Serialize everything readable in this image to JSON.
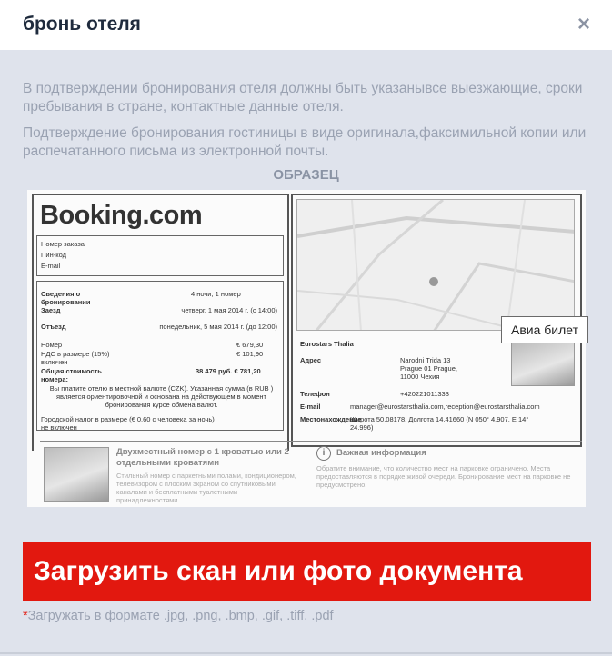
{
  "modal": {
    "title": "бронь отеля",
    "close_glyph": "×"
  },
  "instructions": {
    "paragraph_1": "В подтверждении бронирования отеля должны быть указанывсе выезжающие, сроки пребывания в стране, контактные данные отеля.",
    "paragraph_2": "Подтверждение бронирования гостиницы в виде оригинала,факсимильной копии или распечатанного письма из электронной почты.",
    "sample_label": "ОБРАЗЕЦ"
  },
  "sample_document": {
    "brand": "Booking.com",
    "left_fields": [
      "Номер заказа",
      "Пин-код",
      "E-mail"
    ],
    "details": [
      {
        "label": "Сведения о бронировании",
        "value": "4 ночи, 1 номер"
      },
      {
        "label": "Заезд",
        "value": "четверг, 1 мая 2014 г. (с 14:00)"
      },
      {
        "label": "Отъезд",
        "value": "понедельник, 5 мая 2014 г. (до 12:00)"
      },
      {
        "label": "Номер",
        "value": "€ 679,30"
      },
      {
        "label": "НДС в размере (15%) включен",
        "value": "€ 101,90"
      },
      {
        "label": "Общая стоимость номера:",
        "value": "38 479 руб. € 781,20"
      }
    ],
    "currency_note": "Вы платите отелю в местной валюте (CZK). Указанная сумма (в RUB ) является ориентировочной и основана на действующем в момент бронирования курсе обмена валют.",
    "tax_note": "Городской налог в размере (€ 0.60 с человека за ночь) не включен",
    "hotel_name": "Eurostars Thalia",
    "hotel_fields": [
      {
        "label": "Адрес",
        "value": "Narodni Trida 13 Prague 01 Prague, 11000 Чехия"
      },
      {
        "label": "Телефон",
        "value": "+420221011333"
      },
      {
        "label": "E-mail",
        "value": "manager@eurostarsthalia.com,reception@eurostarsthalia.com"
      },
      {
        "label": "Местонахождение",
        "value": "Широта 50.08178, Долгота 14.41660 (N 050° 4.907, E 14° 24.996)"
      }
    ],
    "room_title": "Двухместный номер с 1 кроватью или 2 отдельными кроватями",
    "room_text": "Стильный номер с паркетными полами, кондиционером, телевизором с плоским экраном со спутниковыми каналами и бесплатными туалетными принадлежностями.",
    "info_title": "Важная информация",
    "info_text": "Обратите внимание, что количество мест на парковке ограничено. Места предоставляются в порядке живой очереди. Бронирование мест на парковке не предусмотрено."
  },
  "tooltip": {
    "text": "Авиа билет"
  },
  "upload": {
    "button_label": "Загрузить скан или фото документа",
    "note_star": "*",
    "note_text": "Загружать в формате .jpg, .png, .bmp, .gif, .tiff, .pdf"
  },
  "colors": {
    "accent": "#e2180f",
    "background": "#dfe3ec",
    "muted_text": "#9aa2b2"
  }
}
